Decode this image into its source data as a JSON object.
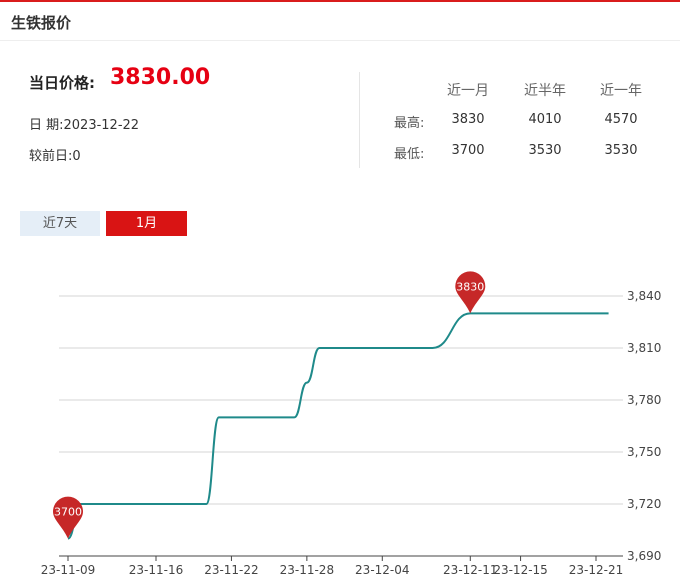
{
  "header": {
    "title": "生铁报价"
  },
  "summary": {
    "price_label": "当日价格:",
    "price_value": "3830.00",
    "date_label": "日 期:",
    "date_value": "2023-12-22",
    "prev_label": "较前日:",
    "prev_value": "0"
  },
  "stats": {
    "columns": [
      "近一月",
      "近半年",
      "近一年"
    ],
    "high_label": "最高:",
    "low_label": "最低:",
    "high": [
      "3830",
      "4010",
      "4570"
    ],
    "low": [
      "3700",
      "3530",
      "3530"
    ]
  },
  "tabs": {
    "week": "近7天",
    "month": "1月"
  },
  "chart_data": {
    "type": "line",
    "title": "",
    "xlabel": "",
    "ylabel": "",
    "x_ticks": [
      "23-11-09",
      "23-11-16",
      "23-11-22",
      "23-11-28",
      "23-12-04",
      "23-12-11",
      "23-12-15",
      "23-12-21"
    ],
    "y_ticks": [
      "3,690",
      "3,720",
      "3,750",
      "3,780",
      "3,810",
      "3,840"
    ],
    "ylim": [
      3690,
      3840
    ],
    "grid": true,
    "line_color": "#1f8a8a",
    "marker_color": "#c62828",
    "series": [
      {
        "points": [
          [
            "23-11-09",
            3700
          ],
          [
            "23-11-10",
            3720
          ],
          [
            "23-11-11",
            3720
          ],
          [
            "23-11-12",
            3720
          ],
          [
            "23-11-13",
            3720
          ],
          [
            "23-11-14",
            3720
          ],
          [
            "23-11-15",
            3720
          ],
          [
            "23-11-16",
            3720
          ],
          [
            "23-11-17",
            3720
          ],
          [
            "23-11-18",
            3720
          ],
          [
            "23-11-19",
            3720
          ],
          [
            "23-11-20",
            3720
          ],
          [
            "23-11-21",
            3770
          ],
          [
            "23-11-22",
            3770
          ],
          [
            "23-11-23",
            3770
          ],
          [
            "23-11-24",
            3770
          ],
          [
            "23-11-25",
            3770
          ],
          [
            "23-11-26",
            3770
          ],
          [
            "23-11-27",
            3770
          ],
          [
            "23-11-28",
            3790
          ],
          [
            "23-11-29",
            3810
          ],
          [
            "23-11-30",
            3810
          ],
          [
            "23-12-01",
            3810
          ],
          [
            "23-12-04",
            3810
          ],
          [
            "23-12-05",
            3810
          ],
          [
            "23-12-06",
            3810
          ],
          [
            "23-12-07",
            3810
          ],
          [
            "23-12-08",
            3810
          ],
          [
            "23-12-11",
            3830
          ],
          [
            "23-12-12",
            3830
          ],
          [
            "23-12-13",
            3830
          ],
          [
            "23-12-14",
            3830
          ],
          [
            "23-12-15",
            3830
          ],
          [
            "23-12-18",
            3830
          ],
          [
            "23-12-19",
            3830
          ],
          [
            "23-12-20",
            3830
          ],
          [
            "23-12-21",
            3830
          ],
          [
            "23-12-22",
            3830
          ]
        ]
      }
    ],
    "markers": [
      {
        "x": "23-11-09",
        "value": 3700,
        "label": "3700"
      },
      {
        "x": "23-12-11",
        "value": 3830,
        "label": "3830"
      }
    ]
  }
}
